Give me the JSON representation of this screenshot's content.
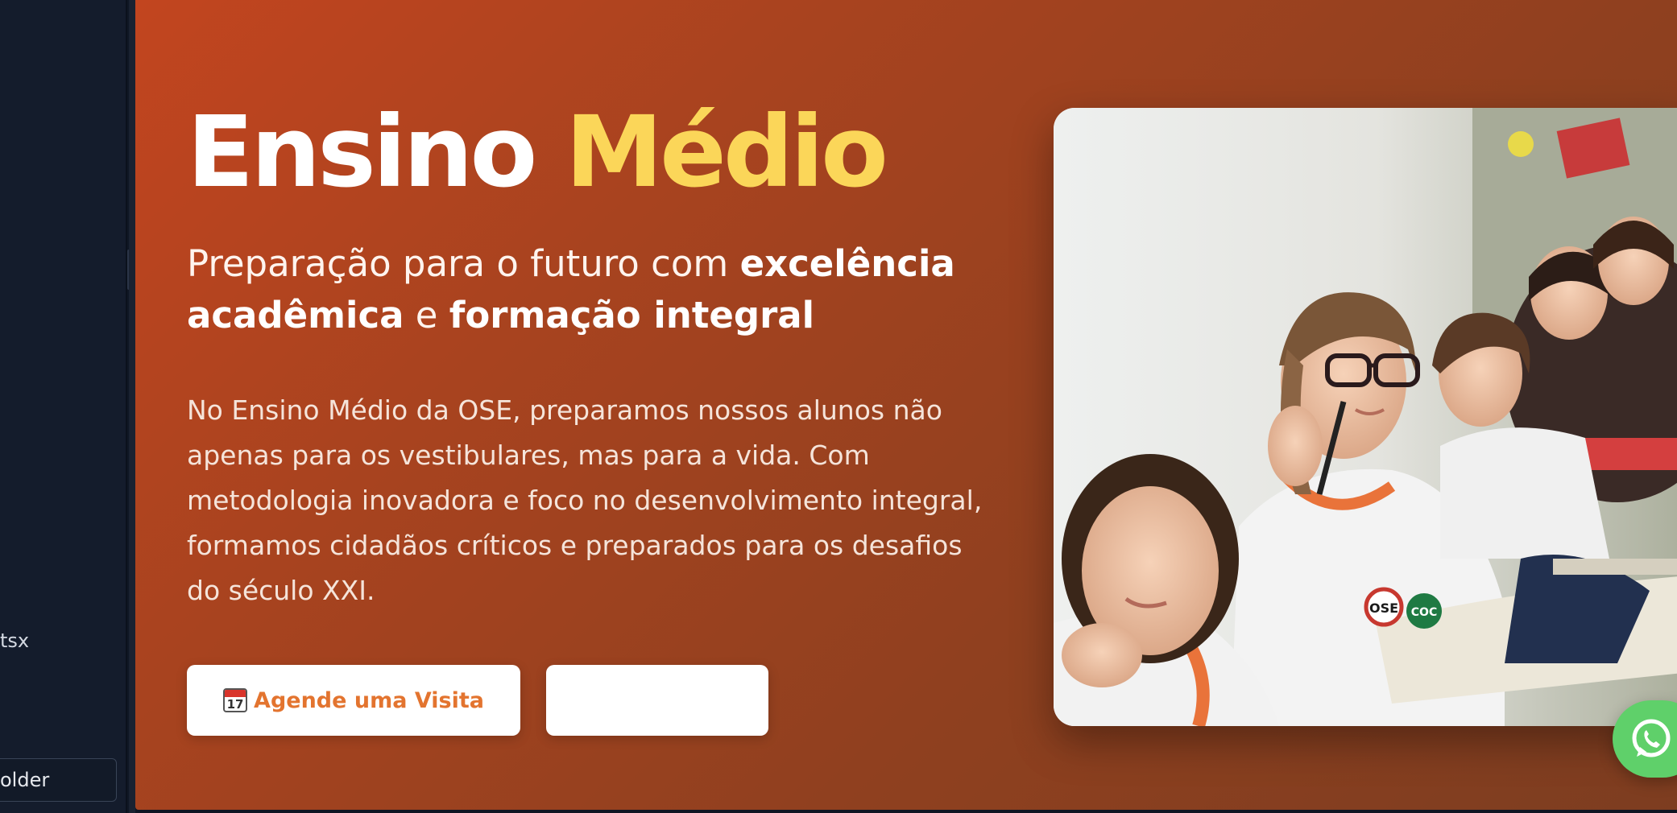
{
  "sidebar": {
    "file_label": "tsx",
    "input_value": "older"
  },
  "hero": {
    "title_main": "Ensino ",
    "title_accent": "Médio",
    "subtitle": {
      "part1": "Preparação para o futuro com ",
      "bold1": "excelência acadêmica",
      "part2": " e ",
      "bold2": "formação integral"
    },
    "description": "No Ensino Médio da OSE, preparamos nossos alunos não apenas para os vestibulares, mas para a vida. Com metodologia inovadora e foco no desenvolvimento integral, formamos cidadãos críticos e preparados para os desafios do século XXI.",
    "buttons": {
      "visit_label": "Agende uma Visita",
      "visit_icon": "calendar-icon",
      "calendar_day": "17",
      "second_label": ""
    },
    "photo": {
      "shirt_badges": [
        "OSE",
        "COC"
      ]
    }
  },
  "colors": {
    "hero_start": "#c2451f",
    "hero_end": "#7d3d20",
    "accent_yellow": "#fbd659",
    "button_text": "#e3742f",
    "whatsapp_green": "#5fd06a",
    "sidebar_bg": "#141c2c"
  },
  "floating": {
    "whatsapp_icon": "whatsapp-icon"
  }
}
